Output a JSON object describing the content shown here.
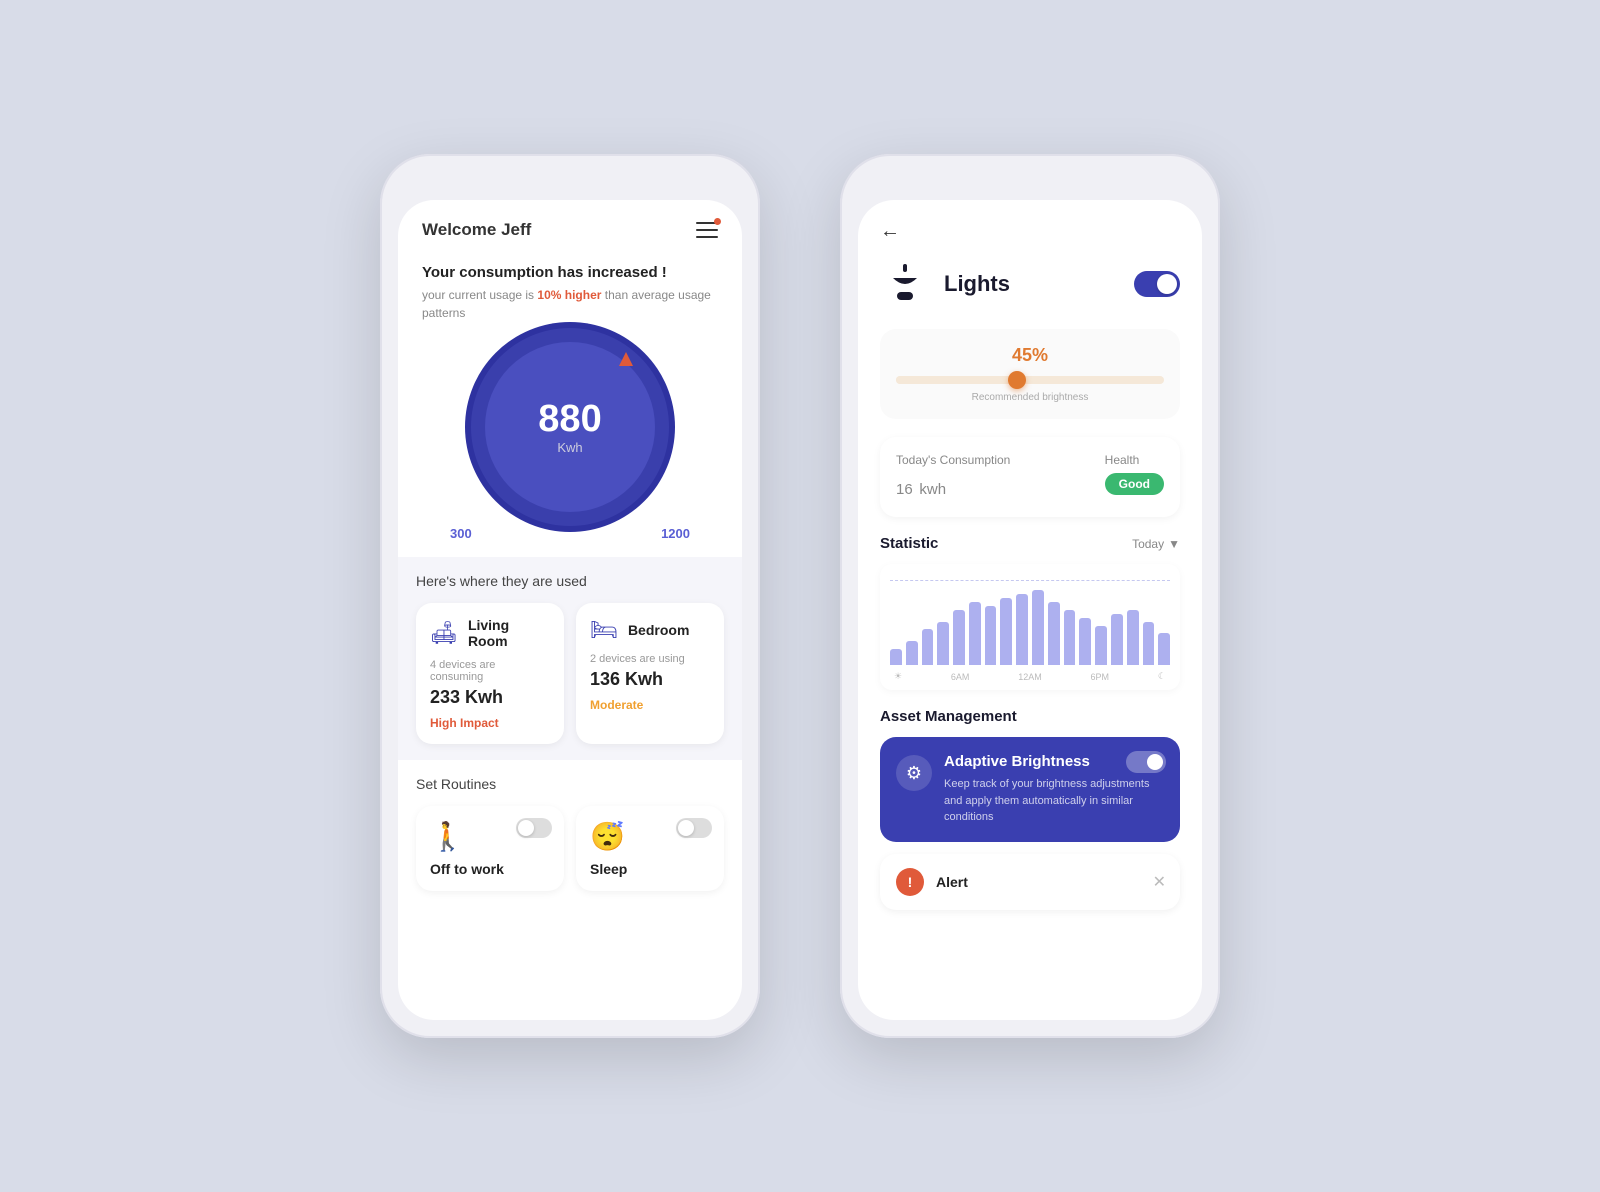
{
  "page": {
    "bg_color": "#d8dce8"
  },
  "phone1": {
    "header": {
      "welcome_text": "Welcome ",
      "user_name": "Jeff",
      "menu_icon": "hamburger"
    },
    "alert": {
      "title": "Your consumption has increased !",
      "desc_prefix": "your current usage is ",
      "highlight": "10% higher",
      "desc_suffix": " than average usage patterns"
    },
    "gauge": {
      "value": "880",
      "unit": "Kwh",
      "min": "300",
      "max": "1200"
    },
    "devices_section": {
      "title": "Here's where they are used",
      "cards": [
        {
          "name": "Living Room",
          "count_text": "4 devices are consuming",
          "kwh": "233 Kwh",
          "impact": "High Impact",
          "impact_class": "high"
        },
        {
          "name": "Bedroom",
          "count_text": "2 devices are using",
          "kwh": "136 Kwh",
          "impact": "Moderate",
          "impact_class": "moderate"
        }
      ]
    },
    "routines_section": {
      "title": "Set Routines",
      "cards": [
        {
          "name": "Off to work",
          "toggle": "off"
        },
        {
          "name": "Sleep",
          "toggle": "off"
        }
      ]
    }
  },
  "phone2": {
    "back_label": "←",
    "device_name": "Lights",
    "toggle_state": "on",
    "brightness": {
      "value": "45%",
      "recommended_label": "Recommended brightness"
    },
    "consumption": {
      "label": "Today's Consumption",
      "value": "16",
      "unit": "kwh"
    },
    "health": {
      "label": "Health",
      "badge": "Good"
    },
    "statistic": {
      "title": "Statistic",
      "filter": "Today",
      "bars": [
        20,
        30,
        45,
        55,
        70,
        80,
        75,
        85,
        90,
        95,
        80,
        70,
        60,
        50,
        65,
        70,
        55,
        40
      ],
      "x_labels": [
        "☀",
        "6AM",
        "12AM",
        "6PM",
        "☾"
      ]
    },
    "asset_management": {
      "title": "Asset Management",
      "card": {
        "name": "Adaptive Brightness",
        "description": "Keep track of your brightness adjustments and apply them automatically in similar conditions",
        "toggle": "on"
      }
    },
    "alert": {
      "label": "Alert"
    }
  }
}
